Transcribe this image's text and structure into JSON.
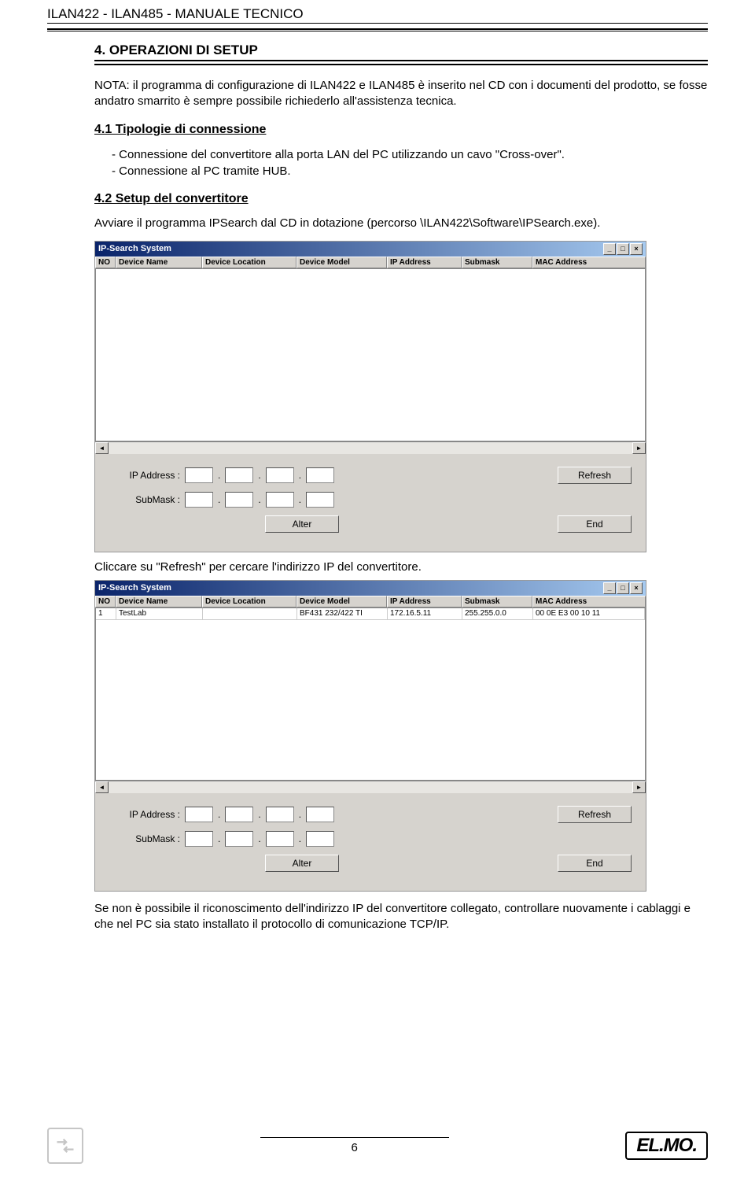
{
  "header": {
    "running_head": "ILAN422  -  ILAN485  -   MANUALE TECNICO"
  },
  "section": {
    "title": "4. OPERAZIONI DI SETUP",
    "nota": "NOTA: il programma di configurazione di ILAN422 e ILAN485 è inserito nel CD con i documenti del prodotto, se fosse andatro smarrito è sempre possibile richiederlo all'assistenza tecnica.",
    "sub41": "4.1 Tipologie di connessione",
    "bullets41a": "-  Connessione del convertitore alla porta LAN del PC utilizzando un cavo \"Cross-over\".",
    "bullets41b": "-  Connessione  al PC tramite HUB.",
    "sub42": "4.2 Setup del convertitore",
    "text42": "Avviare il programma IPSearch dal CD in dotazione (percorso \\ILAN422\\Software\\IPSearch.exe).",
    "caption1": "Cliccare su \"Refresh\" per cercare l'indirizzo IP del convertitore.",
    "trailing": "Se non è possibile il riconoscimento dell'indirizzo IP del convertitore collegato, controllare nuovamente i cablaggi e che nel PC sia stato installato il protocollo di comunicazione TCP/IP."
  },
  "ipsearch": {
    "title": "IP-Search System",
    "columns": {
      "no": "NO",
      "dn": "Device Name",
      "dl": "Device Location",
      "dm": "Device Model",
      "ip": "IP Address",
      "sm": "Submask",
      "mac": "MAC Address"
    },
    "labels": {
      "ip": "IP Address :",
      "sm": "SubMask :"
    },
    "buttons": {
      "refresh": "Refresh",
      "end": "End",
      "alter": "Alter"
    },
    "tb": {
      "min": "_",
      "max": "□",
      "close": "×"
    },
    "arrows": {
      "left": "◄",
      "right": "►"
    },
    "row1": {
      "no": "1",
      "dn": "TestLab",
      "dl": "",
      "dm": "BF431 232/422 TI",
      "ip": "172.16.5.11",
      "sm": "255.255.0.0",
      "mac": "00 0E E3 00 10 11"
    }
  },
  "footer": {
    "page": "6",
    "logo": "EL.MO."
  }
}
